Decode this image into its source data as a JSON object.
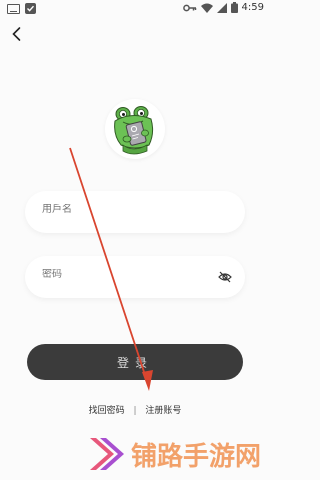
{
  "status_bar": {
    "time": "4:59"
  },
  "icons": {
    "keyboard": "keyboard-icon",
    "check": "check-icon",
    "key": "key-icon",
    "wifi": "wifi-icon",
    "signal": "signal-icon",
    "battery": "battery-icon",
    "back": "back-arrow-icon",
    "eye": "eye-off-icon"
  },
  "login_form": {
    "username_placeholder": "用戶名",
    "password_placeholder": "密码",
    "login_label": "登录",
    "forgot_password": "找回密码",
    "separator": "|",
    "register": "注册账号"
  },
  "watermark": {
    "text": "铺路手游网"
  },
  "colors": {
    "background": "#fbfbfb",
    "button": "#3b3b3b",
    "button_text": "#dcdcdc",
    "annotation_arrow": "#d9452f",
    "watermark": "#f2a16a"
  }
}
